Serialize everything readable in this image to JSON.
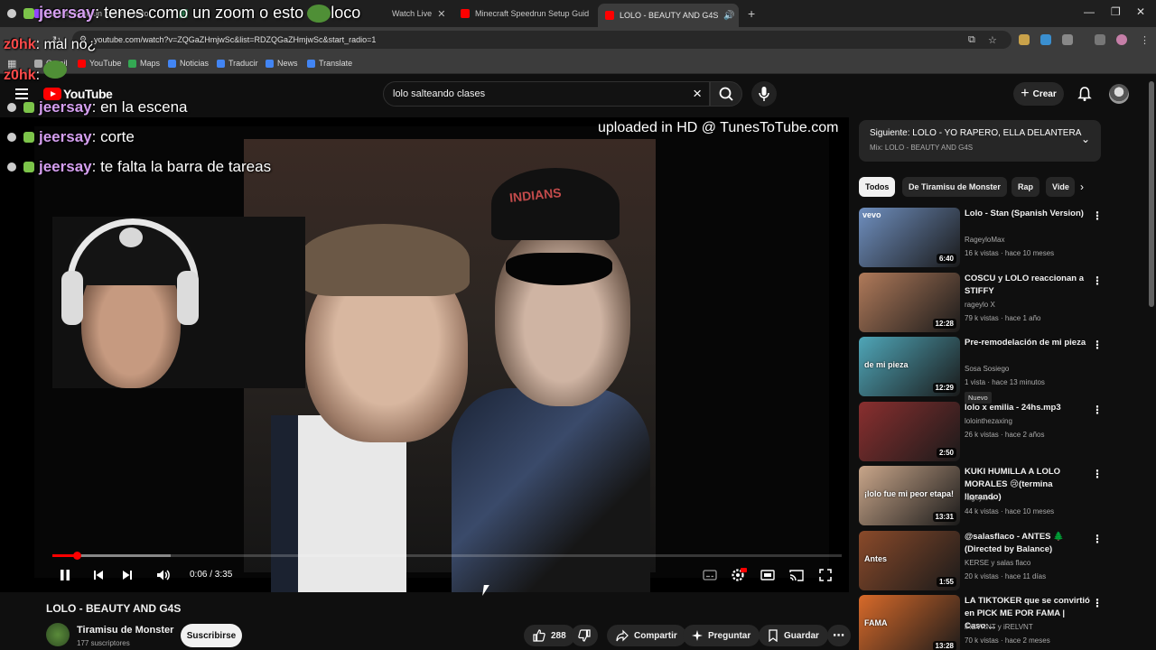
{
  "browser": {
    "tabs": [
      {
        "title": "tenes como un zoom o esto",
        "color": "#9146ff"
      },
      {
        "title": "Watch Live",
        "color": "#2e8b57"
      },
      {
        "title": "Minecraft Speedrun Setup Guid",
        "color": "#ff0000"
      },
      {
        "title": "LOLO - BEAUTY AND G4S",
        "color": "#ff0000"
      }
    ],
    "url": "youtube.com/watch?v=ZQGaZHmjwSc&list=RDZQGaZHmjwSc&start_radio=1",
    "bookmarks": [
      "Gmail",
      "YouTube",
      "Maps",
      "Noticias",
      "Traducir",
      "News",
      "Translate"
    ]
  },
  "masthead": {
    "logo": "YouTube",
    "search_value": "lolo salteando clases",
    "create_label": "Crear"
  },
  "player": {
    "watermark": "uploaded in HD @ TunesToTube.com",
    "time": "0:06 / 3:35",
    "progress_fraction": 0.028,
    "buffered_fraction": 0.15,
    "cap_text": "INDIANS"
  },
  "chat": [
    {
      "user": "jeersay",
      "msg": ": tenes como un zoom o esto",
      "extra": "loco"
    },
    {
      "user": "z0hk",
      "msg": ": mal no¿"
    },
    {
      "user": "z0hk",
      "msg": ":"
    },
    {
      "user": "jeersay",
      "msg": ": en la escena"
    },
    {
      "user": "jeersay",
      "msg": ": corte"
    },
    {
      "user": "jeersay",
      "msg": ": te falta la barra de tareas"
    }
  ],
  "video": {
    "title": "LOLO - BEAUTY AND G4S",
    "channel": "Tiramisu de Monster",
    "subscribers": "177 suscriptores",
    "subscribe_label": "Suscribirse",
    "likes": "288",
    "share_label": "Compartir",
    "ask_label": "Preguntar",
    "save_label": "Guardar"
  },
  "sidebar": {
    "next_title": "Siguiente: LOLO - YO RAPERO, ELLA DELANTERA",
    "next_sub": "Mix: LOLO - BEAUTY AND G4S",
    "chips": [
      "Todos",
      "De Tiramisu de Monster",
      "Rap",
      "Vide"
    ],
    "recommendations": [
      {
        "title": "Lolo - Stan (Spanish Version)",
        "channel": "RageyloMax",
        "meta": "16 k vistas · hace 10 meses",
        "duration": "6:40",
        "thumb": "#6f8fbf",
        "badge": "vevo"
      },
      {
        "title": "COSCU y LOLO reaccionan a STIFFY",
        "channel": "rageylo X",
        "meta": "79 k vistas · hace 1 año",
        "duration": "12:28",
        "thumb": "#b07a5a"
      },
      {
        "title": "Pre-remodelación de mi pieza",
        "channel": "Sosa Sosiego",
        "meta": "1 vista · hace 13 minutos",
        "duration": "12:29",
        "thumb": "#4fa6b8",
        "new": "Nuevo",
        "overlay": "de mi pieza"
      },
      {
        "title": "lolo x emilia - 24hs.mp3",
        "channel": "lolointhezaxing",
        "meta": "26 k vistas · hace 2 años",
        "duration": "2:50",
        "thumb": "#8a2f2f"
      },
      {
        "title": "KUKI HUMILLA A LOLO MORALES 😢(termina llorando)",
        "channel": "rageylo fr",
        "meta": "44 k vistas · hace 10 meses",
        "duration": "13:31",
        "thumb": "#c9a68a",
        "overlay": "¡lolo fue mi peor etapa!"
      },
      {
        "title": "@salasflaco - ANTES 🌲 (Directed by Balance)",
        "channel": "KERSE y salas flaco",
        "meta": "20 k vistas · hace 11 días",
        "duration": "1:55",
        "thumb": "#8a4a2a",
        "overlay": "Antes"
      },
      {
        "title": "LA TIKTOKER que se convirtió en PICK ME POR FAMA | Caso:...",
        "channel": "iREVRNT y iRELVNT",
        "meta": "70 k vistas · hace 2 meses",
        "duration": "13:28",
        "thumb": "#d86a2a",
        "overlay": "FAMA"
      }
    ]
  }
}
